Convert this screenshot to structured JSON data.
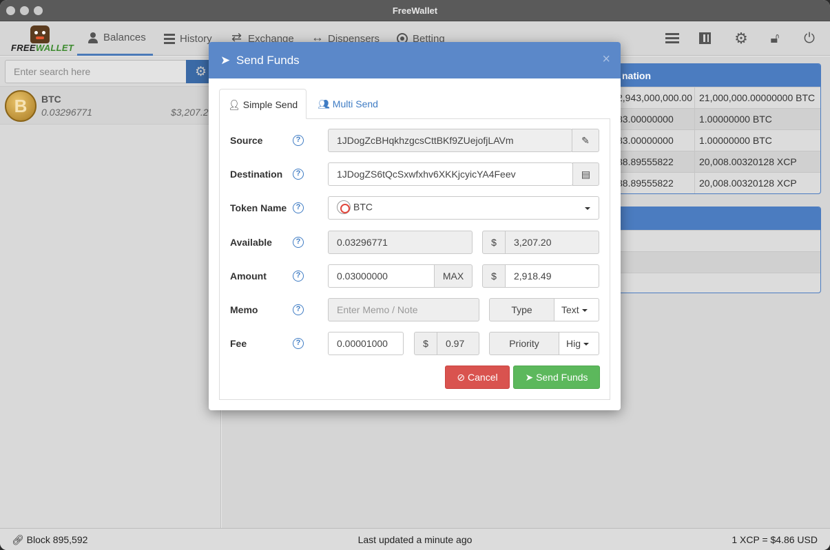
{
  "window": {
    "title": "FreeWallet"
  },
  "logo": {
    "text_free": "FREE",
    "text_wallet": "WALLET"
  },
  "nav": {
    "balances": "Balances",
    "history": "History",
    "exchange": "Exchange",
    "dispensers": "Dispensers",
    "betting": "Betting"
  },
  "search": {
    "placeholder": "Enter search here"
  },
  "token_list": [
    {
      "symbol": "BTC",
      "quantity": "0.03296771",
      "usd": "$3,207.20"
    }
  ],
  "right_panel": {
    "header": "nation",
    "rows": [
      {
        "c1": "2,943,000,000.00",
        "c2": "21,000,000.00000000 BTC"
      },
      {
        "c1": "83.00000000",
        "c2": "1.00000000 BTC"
      },
      {
        "c1": "83.00000000",
        "c2": "1.00000000 BTC"
      },
      {
        "c1": "38.89555822",
        "c2": "20,008.00320128 XCP"
      },
      {
        "c1": "38.89555822",
        "c2": "20,008.00320128 XCP"
      }
    ]
  },
  "modal": {
    "title": "Send Funds",
    "close": "×",
    "tabs": {
      "simple": "Simple Send",
      "multi": "Multi Send"
    },
    "labels": {
      "source": "Source",
      "destination": "Destination",
      "token_name": "Token Name",
      "available": "Available",
      "amount": "Amount",
      "memo": "Memo",
      "fee": "Fee"
    },
    "help": "?",
    "source": "1JDogZcBHqkhzgcsCttBKf9ZUejofjLAVm",
    "destination": "1JDogZS6tQcSxwfxhv6XKKjcyicYA4Feev",
    "token": "BTC",
    "available": "0.03296771",
    "available_usd": "3,207.20",
    "amount": "0.03000000",
    "max_label": "MAX",
    "amount_usd": "2,918.49",
    "currency_symbol": "$",
    "memo_placeholder": "Enter Memo / Note",
    "type_label": "Type",
    "type_value": "Text",
    "fee": "0.00001000",
    "fee_usd": "0.97",
    "priority_label": "Priority",
    "priority_value": "Hig",
    "cancel": "Cancel",
    "send": "Send Funds"
  },
  "status": {
    "block": "Block 895,592",
    "updated": "Last updated a minute ago",
    "rate": "1 XCP = $4.86 USD"
  }
}
